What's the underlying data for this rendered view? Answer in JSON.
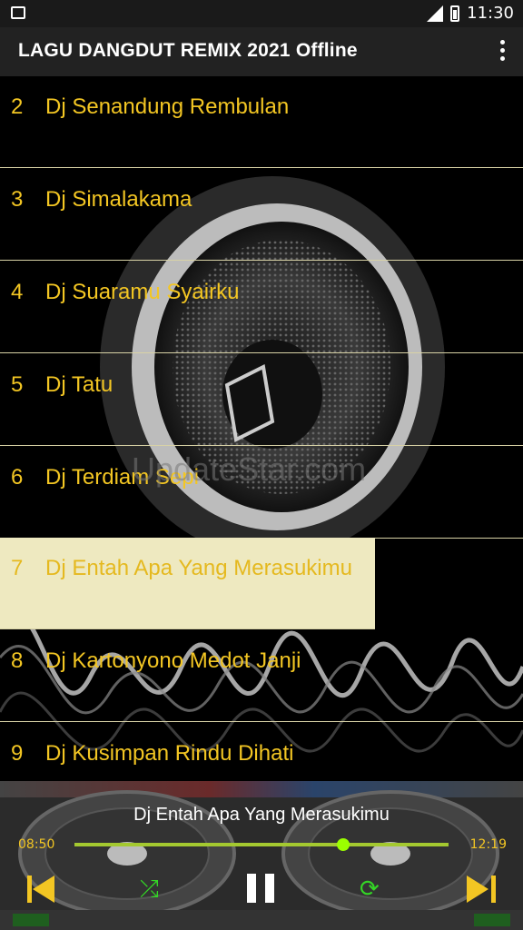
{
  "status_bar": {
    "time": "11:30"
  },
  "app_bar": {
    "title": "LAGU DANGDUT REMIX 2021 Offline"
  },
  "songs": [
    {
      "num": "2",
      "title": "Dj Senandung Rembulan"
    },
    {
      "num": "3",
      "title": "Dj Simalakama"
    },
    {
      "num": "4",
      "title": "Dj Suaramu Syairku"
    },
    {
      "num": "5",
      "title": "Dj Tatu"
    },
    {
      "num": "6",
      "title": "Dj Terdiam Sepi"
    },
    {
      "num": "7",
      "title": "Dj Entah Apa Yang Merasukimu"
    },
    {
      "num": "8",
      "title": "Dj Kartonyono Medot Janji"
    },
    {
      "num": "9",
      "title": "Dj Kusimpan Rindu Dihati"
    }
  ],
  "selected_index": 5,
  "watermark": "UpdateStar.com",
  "player": {
    "now_playing": "Dj Entah Apa Yang Merasukimu",
    "elapsed": "08:50",
    "duration": "12:19",
    "progress": 0.7177
  },
  "colors": {
    "accent": "#f3c623",
    "selected_bg": "#eee9c0",
    "control_green": "#34d626"
  },
  "icons": [
    "image-icon",
    "signal-icon",
    "battery-icon",
    "overflow-menu-icon",
    "skip-previous-icon",
    "shuffle-icon",
    "pause-icon",
    "repeat-icon",
    "skip-next-icon"
  ]
}
